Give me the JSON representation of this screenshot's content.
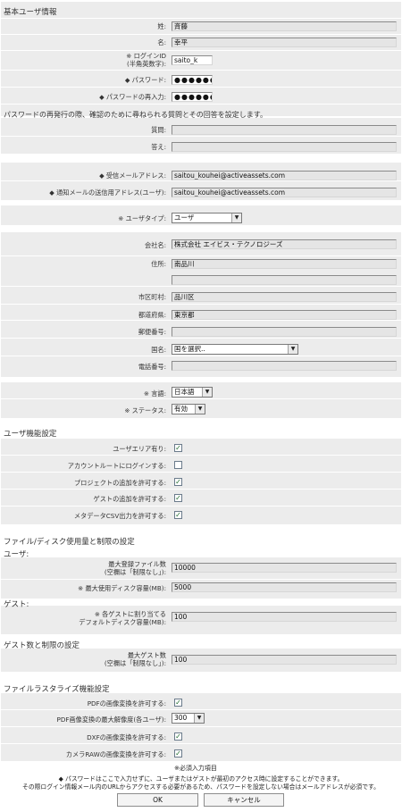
{
  "sections": {
    "basic": "基本ユーザ情報",
    "security_question": "パスワードの再発行の際、確認のために尋ねられる質問とその回答を設定します。",
    "user_functions": "ユーザ機能設定",
    "file_disk_limits": "ファイル/ディスク使用量と制限の設定",
    "user_sub": "ユーザ:",
    "guest_sub": "ゲスト:",
    "guest_limits": "ゲスト数と制限の設定",
    "rasterize": "ファイルラスタライズ機能設定"
  },
  "fields": {
    "last_name": {
      "label": "姓:",
      "value": "斉藤"
    },
    "first_name": {
      "label": "名:",
      "value": "幸平"
    },
    "login_id": {
      "label1": "※ ログインID",
      "label2": "(半角英数字):",
      "value": "saito_k"
    },
    "password": {
      "label": "◆ パスワード:",
      "value": "●●●●●●●"
    },
    "password_confirm": {
      "label": "◆ パスワードの再入力:",
      "value": "●●●●●●●"
    },
    "question": {
      "label": "質問:",
      "value": ""
    },
    "answer": {
      "label": "答え:",
      "value": ""
    },
    "receive_email": {
      "label": "◆ 受信メールアドレス:",
      "value": "saitou_kouhei@activeassets.com"
    },
    "notify_email": {
      "label": "◆ 通知メールの送信用アドレス(ユーザ):",
      "value": "saitou_kouhei@activeassets.com"
    },
    "user_type": {
      "label": "※ ユーザタイプ:",
      "value": "ユーザ"
    },
    "company": {
      "label": "会社名:",
      "value": "株式会社 エイビス・テクノロジーズ"
    },
    "address": {
      "label": "住所:",
      "value": "南品川",
      "value2": ""
    },
    "city": {
      "label": "市区町村:",
      "value": "品川区"
    },
    "prefecture": {
      "label": "都道府県:",
      "value": "東京都"
    },
    "postal": {
      "label": "郵便番号:",
      "value": ""
    },
    "country": {
      "label": "国名:",
      "value": "国を選択.."
    },
    "phone": {
      "label": "電話番号:",
      "value": ""
    },
    "language": {
      "label": "※ 言語:",
      "value": "日本語"
    },
    "status": {
      "label": "※ ステータス:",
      "value": "有効"
    }
  },
  "user_functions": [
    {
      "label": "ユーザエリア有り:",
      "checked": true
    },
    {
      "label": "アカウントルートにログインする:",
      "checked": false
    },
    {
      "label": "プロジェクトの追加を許可する:",
      "checked": true
    },
    {
      "label": "ゲストの追加を許可する:",
      "checked": true
    },
    {
      "label": "メタデータCSV出力を許可する:",
      "checked": true
    }
  ],
  "limits": {
    "max_files": {
      "label1": "最大登録ファイル数",
      "label2": "(空欄は「制限なし」):",
      "value": "10000"
    },
    "max_disk": {
      "label": "※ 最大使用ディスク容量(MB):",
      "value": "5000"
    },
    "guest_disk": {
      "label1": "※ 各ゲストに割り当てる",
      "label2": "デフォルトディスク容量(MB):",
      "value": "100"
    },
    "max_guests": {
      "label1": "最大ゲスト数",
      "label2": "(空欄は「制限なし」):",
      "value": "100"
    }
  },
  "rasterize": {
    "pdf_convert": {
      "label": "PDFの画像変換を許可する:",
      "checked": true
    },
    "pdf_resolution": {
      "label": "PDF画像変換の最大解像度(各ユーザ):",
      "value": "300"
    },
    "dxf_convert": {
      "label": "DXFの画像変換を許可する:",
      "checked": true
    },
    "raw_convert": {
      "label": "カメラRAWの画像変換を許可する:",
      "checked": true
    }
  },
  "notes": {
    "required": "※必須入力項目",
    "line1": "◆ パスワードはここで入力せずに、ユーザまたはゲストが最初のアクセス時に設定することができます。",
    "line2": "その際ログイン情報メール内のURLからアクセスする必要があるため、パスワードを設定しない場合はメールアドレスが必須です。"
  },
  "buttons": {
    "ok": "OK",
    "cancel": "キャンセル"
  },
  "colors": {
    "band": "#ececec",
    "check": "#1f6b2e"
  }
}
